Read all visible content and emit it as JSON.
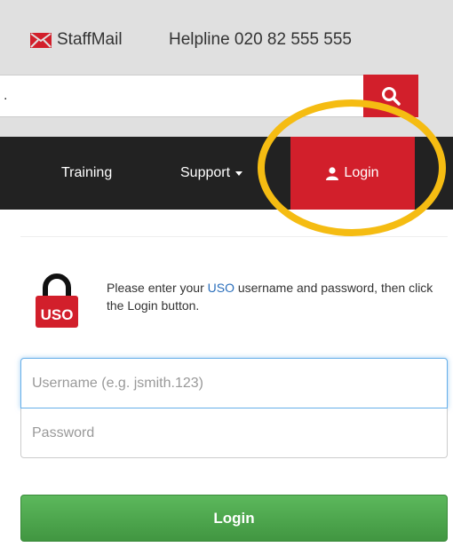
{
  "header": {
    "staffmail_label": "StaffMail",
    "helpline_text": "Helpline 020 82 555 555",
    "mail_icon": "envelope-icon"
  },
  "search": {
    "value": ".",
    "icon": "search-icon"
  },
  "nav": {
    "training_label": "Training",
    "support_label": "Support",
    "login_label": "Login",
    "login_icon": "user-icon"
  },
  "uso": {
    "badge_text": "USO",
    "icon": "padlock-icon",
    "text_before": "Please enter your ",
    "link_text": "USO",
    "text_after": " username and password, then click the Login button."
  },
  "form": {
    "username_placeholder": "Username (e.g. jsmith.123)",
    "password_placeholder": "Password",
    "submit_label": "Login"
  },
  "colors": {
    "brand_red": "#d21f2b",
    "navbar": "#222222",
    "highlight": "#f5bc12",
    "login_green": "#5cb85c",
    "link_blue": "#2a6ebb"
  }
}
